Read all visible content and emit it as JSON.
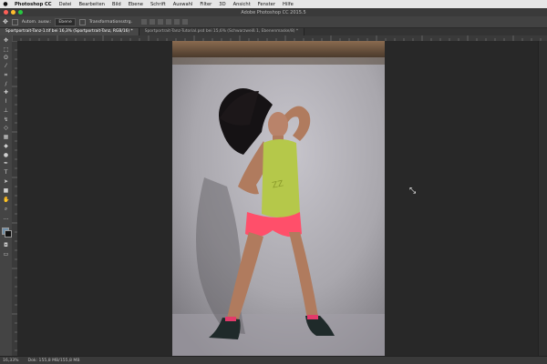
{
  "menubar": {
    "app_name": "Photoshop CC",
    "items": [
      "Datei",
      "Bearbeiten",
      "Bild",
      "Ebene",
      "Schrift",
      "Auswahl",
      "Filter",
      "3D",
      "Ansicht",
      "Fenster",
      "Hilfe"
    ]
  },
  "window": {
    "title": "Adobe Photoshop CC 2015.5"
  },
  "options_bar": {
    "auto_select_label": "Autom. ausw.:",
    "auto_select_target": "Ebene",
    "transform_label": "Transformationsstrg."
  },
  "tabs": [
    {
      "label": "Sportportrait-Tanz-1.tif bei 16,3% (Sportportrait-Tanz, RGB/16) *"
    },
    {
      "label": "Sportportrait-Tanz-Tutorial.psd bei 15,6% (Schwarzweiß 1, Ebenenmaske/8) *"
    }
  ],
  "status": {
    "zoom": "16,33%",
    "doc": "Dok: 155,8 MB/155,8 MB"
  },
  "colors": {
    "accent": "#3b82c4",
    "backdrop": "#b4b2ba",
    "top_strip": "#6b4f3b",
    "tank_top": "#b5c84a",
    "shorts": "#ff4f6a"
  },
  "icons": [
    "apple-icon",
    "move-tool-icon",
    "marquee-icon",
    "lasso-icon",
    "quick-select-icon",
    "crop-icon",
    "eyedropper-icon",
    "heal-icon",
    "brush-icon",
    "stamp-icon",
    "history-brush-icon",
    "eraser-icon",
    "gradient-icon",
    "blur-icon",
    "dodge-icon",
    "pen-icon",
    "type-icon",
    "path-select-icon",
    "shape-icon",
    "hand-icon",
    "zoom-icon",
    "more-icon"
  ]
}
